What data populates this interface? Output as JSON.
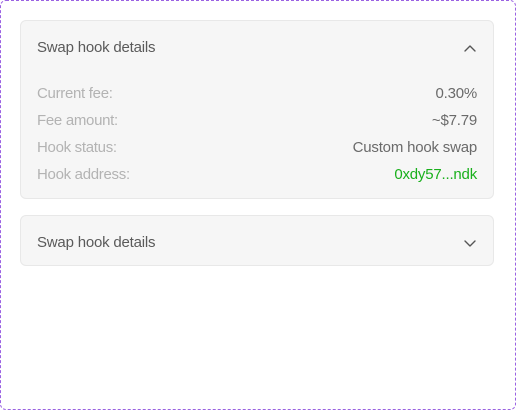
{
  "panels": [
    {
      "title": "Swap hook details",
      "expanded": true,
      "chevron_icon": "chevron-up-icon",
      "rows": [
        {
          "label": "Current fee:",
          "value": "0.30%"
        },
        {
          "label": "Fee amount:",
          "value": "~$7.79"
        },
        {
          "label": "Hook status:",
          "value": "Custom hook swap"
        },
        {
          "label": "Hook address:",
          "value": "0xdy57...ndk"
        }
      ]
    },
    {
      "title": "Swap hook details",
      "expanded": false,
      "chevron_icon": "chevron-down-icon"
    }
  ],
  "colors": {
    "frame_border": "#9a62e2",
    "panel_bg": "#f6f6f6",
    "label_text": "#b3b3b3",
    "value_text": "#6a6a6a",
    "address_link": "#19b01c"
  }
}
